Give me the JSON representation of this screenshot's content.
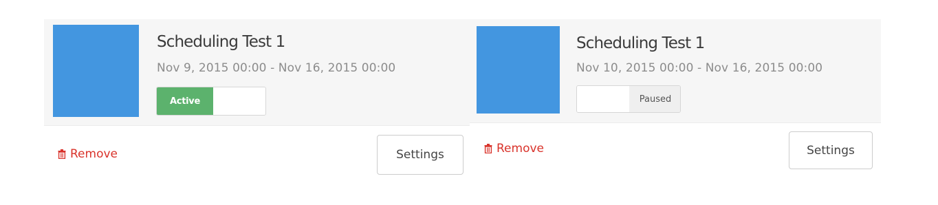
{
  "cards": [
    {
      "title": "Scheduling Test 1",
      "date_range": "Nov 9, 2015 00:00 - Nov 16, 2015 00:00",
      "status_label": "Active",
      "status": "active",
      "remove_label": "Remove",
      "settings_label": "Settings",
      "thumbnail_color": "#4396e0"
    },
    {
      "title": "Scheduling Test 1",
      "date_range": "Nov 10, 2015 00:00 - Nov 16, 2015 00:00",
      "status_label": "Paused",
      "status": "paused",
      "remove_label": "Remove",
      "settings_label": "Settings",
      "thumbnail_color": "#4396e0"
    }
  ],
  "colors": {
    "active_green": "#5cb26d",
    "remove_red": "#d9332b",
    "card_background": "#f6f6f6"
  },
  "icons": {
    "remove": "trash-icon"
  }
}
